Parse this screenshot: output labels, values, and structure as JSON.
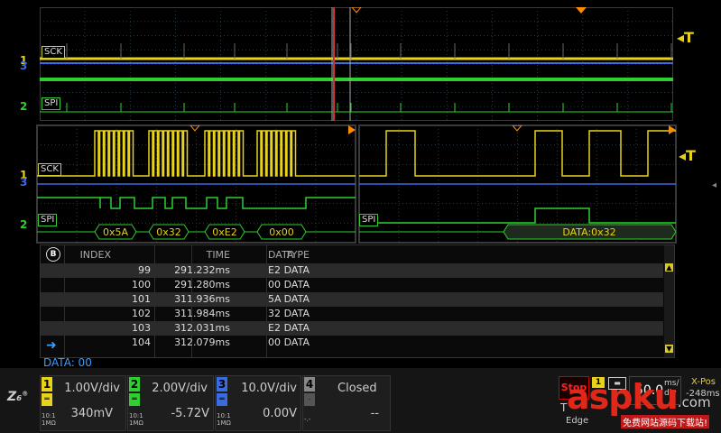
{
  "colors": {
    "ch1": "#e8d21a",
    "ch2": "#2fcf2f",
    "ch3": "#3a6be0",
    "ch4": "#888888",
    "trigger": "#ff8a00",
    "grid": "#2a3a44"
  },
  "top_panel": {
    "labels": {
      "sck": "SCK",
      "spi": "SPI"
    },
    "ch_markers": {
      "ch1": "1",
      "ch3": "3",
      "ch2": "2"
    },
    "trigger_label": "T"
  },
  "zoom_left": {
    "labels": {
      "sck": "SCK",
      "spi": "SPI"
    },
    "ch_markers": {
      "ch1": "1",
      "ch3": "3",
      "ch2": "2"
    },
    "decode_values": [
      "0x5A",
      "0x32",
      "0xE2",
      "0x00"
    ]
  },
  "zoom_right": {
    "labels": {
      "spi": "SPI"
    },
    "trigger_label": "T",
    "decode_value": "DATA:0x32"
  },
  "decode_table": {
    "headers": {
      "index": "INDEX",
      "time": "TIME",
      "type": "TYPE",
      "data": "DATA"
    },
    "badge": "B",
    "rows": [
      {
        "index": "99",
        "time": "291.232ms",
        "type": "DATA",
        "data": "E2"
      },
      {
        "index": "100",
        "time": "291.280ms",
        "type": "DATA",
        "data": "00"
      },
      {
        "index": "101",
        "time": "311.936ms",
        "type": "DATA",
        "data": "5A"
      },
      {
        "index": "102",
        "time": "311.984ms",
        "type": "DATA",
        "data": "32"
      },
      {
        "index": "103",
        "time": "312.031ms",
        "type": "DATA",
        "data": "E2"
      },
      {
        "index": "104",
        "time": "312.079ms",
        "type": "DATA",
        "data": "00"
      }
    ],
    "status": "DATA: 00"
  },
  "channels": [
    {
      "num": "1",
      "vdiv": "1.00V/div",
      "offset": "340mV",
      "imp1": "10:1",
      "imp2": "1MΩ"
    },
    {
      "num": "2",
      "vdiv": "2.00V/div",
      "offset": "-5.72V",
      "imp1": "10:1",
      "imp2": "1MΩ"
    },
    {
      "num": "3",
      "vdiv": "10.0V/div",
      "offset": "0.00V",
      "imp1": "10:1",
      "imp2": "1MΩ"
    },
    {
      "num": "4",
      "vdiv": "Closed",
      "offset": "--",
      "imp1": "-.-",
      "imp2": ""
    }
  ],
  "status_area": {
    "stop": "Stop",
    "trig_letter": "T",
    "edge": "Edge",
    "timebase": "50.0",
    "timebase_unit": "ms/",
    "timebase_unit2": "div",
    "xpos_label": "X-Pos",
    "xpos_value": "-248ms",
    "trig_ch": "1"
  },
  "watermark": {
    "brand": "aspku",
    "tld": ".com",
    "sub": "免费网站源码下载站!"
  }
}
